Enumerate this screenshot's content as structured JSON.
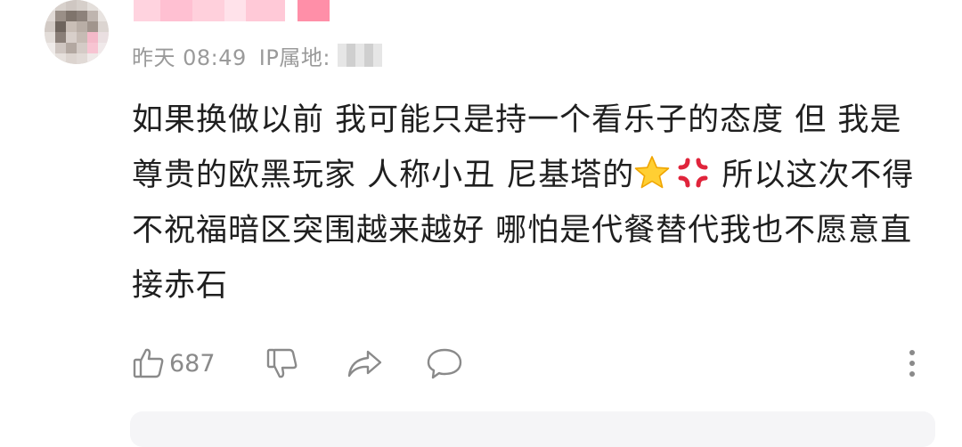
{
  "comment": {
    "author": {
      "avatar": "avatar-image-blurred",
      "name_obscured": true
    },
    "time": "昨天 08:49",
    "ip_label": "IP属地:",
    "ip_value_obscured": true,
    "text_part1": "如果换做以前 我可能只是持一个看乐子的态度 但 我是尊贵的欧黑玩家 人称小丑 尼基塔的",
    "emoji_1": "star-emoji",
    "emoji_2": "anger-symbol-emoji",
    "text_part2": " 所以这次不得不祝福暗区突围越来越好 哪怕是代餐替代我也不愿意直接赤石"
  },
  "actions": {
    "like_icon": "thumbs-up-icon",
    "like_count": "687",
    "dislike_icon": "thumbs-down-icon",
    "share_icon": "share-arrow-icon",
    "reply_icon": "speech-bubble-icon",
    "more_icon": "more-vertical-icon"
  },
  "colors": {
    "meta_text": "#9a9a9a",
    "icon_stroke": "#8a8a8a",
    "pink_name": "#ffc6d6"
  }
}
